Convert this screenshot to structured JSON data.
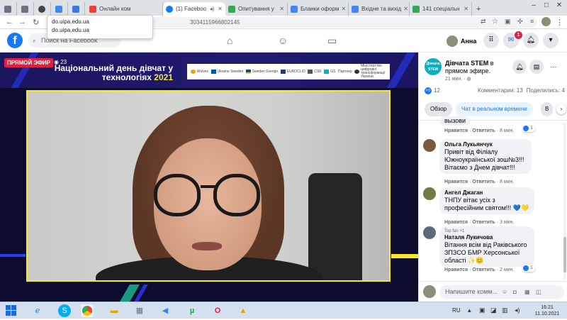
{
  "browser": {
    "tabs": [
      {
        "label": "",
        "favicon_color": "#6b7280"
      },
      {
        "label": "",
        "favicon_color": "#6b7280"
      },
      {
        "label": "",
        "favicon_color": "#444444"
      },
      {
        "label": "",
        "favicon_color": "#4285f4"
      },
      {
        "label": "",
        "favicon_color": "#3c7ae0"
      },
      {
        "label": "Онлайн ком",
        "favicon_color": "#ea4335"
      },
      {
        "label": "(1) Faceboo",
        "favicon_color": "#1877f2",
        "active": true
      },
      {
        "label": "Опитування у",
        "favicon_color": "#34a853"
      },
      {
        "label": "Бланки оформ",
        "favicon_color": "#4285f4"
      },
      {
        "label": "Вхідне та вихід",
        "favicon_color": "#4285f4"
      },
      {
        "label": "141 спеціальн",
        "favicon_color": "#34a853"
      }
    ],
    "url_fragment": "3034115966802145",
    "dropdown": {
      "line1": "do.uipa.edu.ua",
      "line2": "do.uipa.edu.ua"
    },
    "window_controls": [
      "–",
      "□",
      "✕"
    ]
  },
  "facebook": {
    "search_placeholder": "Поиск на Facebook",
    "user_name": "Анна",
    "messenger_badge": "1",
    "logo_letter": "f"
  },
  "video": {
    "live_label": "ПРЯМОЙ ЭФИР",
    "viewer_count": "23",
    "event_title": "Національний день дівчат у технологіях",
    "event_year": "2021",
    "sponsors": [
      "Wolves",
      "Ukraine Sweden",
      "Sweden Sverige",
      "EUROCLIO",
      "CSR",
      "GS",
      "Партнер",
      "Міністерство цифрової трансформації України"
    ]
  },
  "panel": {
    "page_name": "Дівчата STEM",
    "page_status": " в прямом эфире.",
    "page_avatar_text": "Дівчата STEM",
    "time": "21 мин. ·",
    "likes": "12",
    "comments_count": "Комментарии: 13",
    "shares_count": "Поделились: 4",
    "tabs": [
      "Обзор",
      "Чат в реальном времени",
      "В"
    ],
    "comments": [
      {
        "name": "",
        "text": "вызови",
        "like": "Нравится",
        "reply": "Ответить",
        "time": "8 мин.",
        "reactions": "1",
        "avatar_color": "#9a8f6d"
      },
      {
        "name": "Ольга Лукьянчук",
        "text": "Привіт від Філіалу Южноукраїнської зош№3!!! Вітаємо з Днем дівчат!!!",
        "like": "Нравится",
        "reply": "Ответить",
        "time": "8 мин.",
        "reactions": "",
        "avatar_color": "#7b5b3a"
      },
      {
        "name": "Ангел Джаган",
        "text": "ТНПУ вітає усіх з професійним святом!!! 💙💛",
        "like": "Нравится",
        "reply": "Ответить",
        "time": "3 мин.",
        "reactions": "",
        "avatar_color": "#6d7d45"
      },
      {
        "top_fan": "Top fan +1",
        "name": "Наталя Лукичова",
        "text": "Вітання всім від Раківського ЗПЗСО БМР Херсонської області ✨😊",
        "like": "Нравится",
        "reply": "Ответить",
        "time": "2 мин.",
        "reactions": "1",
        "avatar_color": "#5c6b7a"
      }
    ],
    "comment_placeholder": "Напишите комм..."
  },
  "taskbar": {
    "language": "RU",
    "time": "16:21",
    "date": "11.10.2021"
  },
  "colors": {
    "fb_blue": "#1877f2",
    "live_red": "#e41e3f",
    "event_yellow": "#f6e72a",
    "event_navy": "#1a1660"
  }
}
